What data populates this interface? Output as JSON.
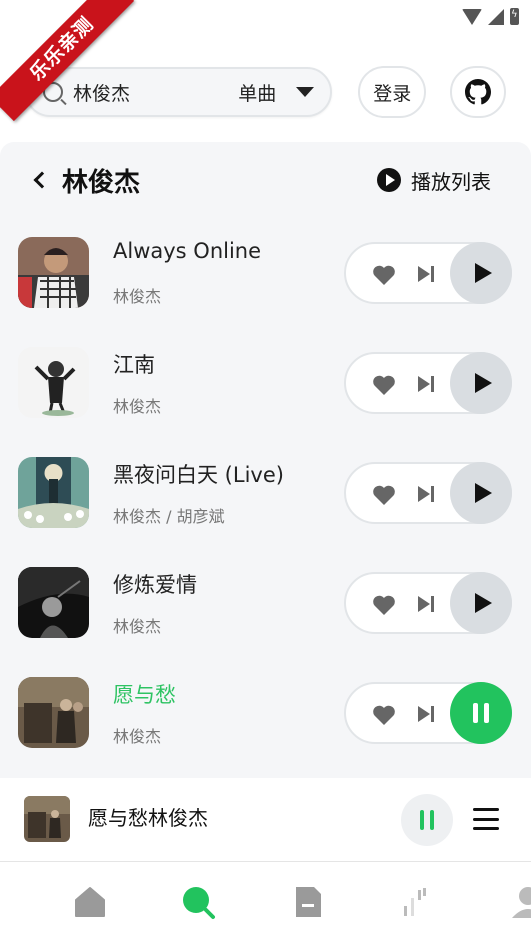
{
  "ribbon_text": "乐乐亲测",
  "search": {
    "query": "林俊杰",
    "type": "单曲"
  },
  "header": {
    "login_label": "登录"
  },
  "panel": {
    "title": "林俊杰",
    "playlist_label": "播放列表"
  },
  "songs": [
    {
      "name": "Always Online",
      "artist": "林俊杰",
      "active": false
    },
    {
      "name": "江南",
      "artist": "林俊杰",
      "active": false
    },
    {
      "name": "黑夜问白天 (Live)",
      "artist": "林俊杰 / 胡彦斌",
      "active": false
    },
    {
      "name": "修炼爱情",
      "artist": "林俊杰",
      "active": false
    },
    {
      "name": "愿与愁",
      "artist": "林俊杰",
      "active": true
    }
  ],
  "mini_player": {
    "title": "愿与愁林俊杰"
  },
  "nav": [
    {
      "icon": "home-icon",
      "active": false
    },
    {
      "icon": "search-icon",
      "active": true
    },
    {
      "icon": "document-icon",
      "active": false
    },
    {
      "icon": "chart-icon",
      "active": false
    },
    {
      "icon": "user-icon",
      "active": false
    }
  ],
  "colors": {
    "accent": "#22c35e",
    "ribbon": "#c9131b",
    "panel_bg": "#f5f6f8"
  }
}
